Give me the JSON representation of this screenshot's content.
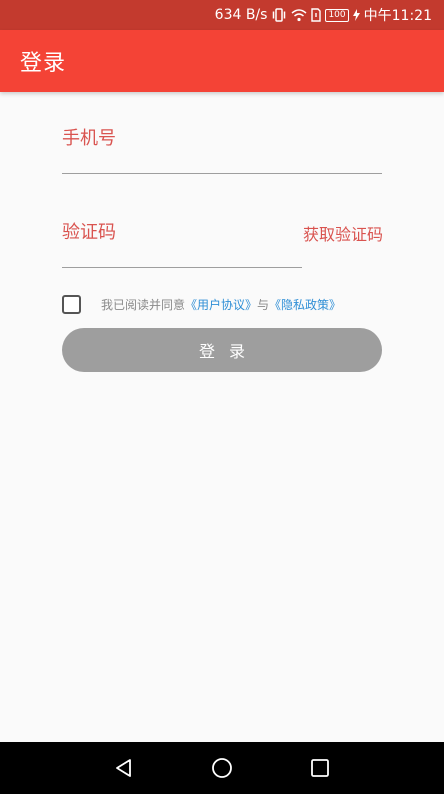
{
  "status_bar": {
    "speed": "634 B/s",
    "battery": "100",
    "time": "中午11:21"
  },
  "app_bar": {
    "title": "登录"
  },
  "form": {
    "phone_placeholder": "手机号",
    "code_placeholder": "验证码",
    "get_code_label": "获取验证码"
  },
  "agreement": {
    "prefix": "我已阅读并同意",
    "user_agreement": "《用户协议》",
    "conjunction": "与",
    "privacy_policy": "《隐私政策》",
    "checked": false
  },
  "login_button": {
    "label": "登录"
  },
  "colors": {
    "primary": "#f44336",
    "status_bar": "#c33a2e",
    "hint_text": "#d9534f",
    "link": "#2f8fd6",
    "disabled_button": "#9e9e9e"
  },
  "icons": {
    "status": [
      "vibrate-icon",
      "wifi-icon",
      "sim-icon",
      "battery-icon",
      "charging-icon"
    ],
    "nav": [
      "back-icon",
      "home-icon",
      "recent-apps-icon"
    ]
  }
}
